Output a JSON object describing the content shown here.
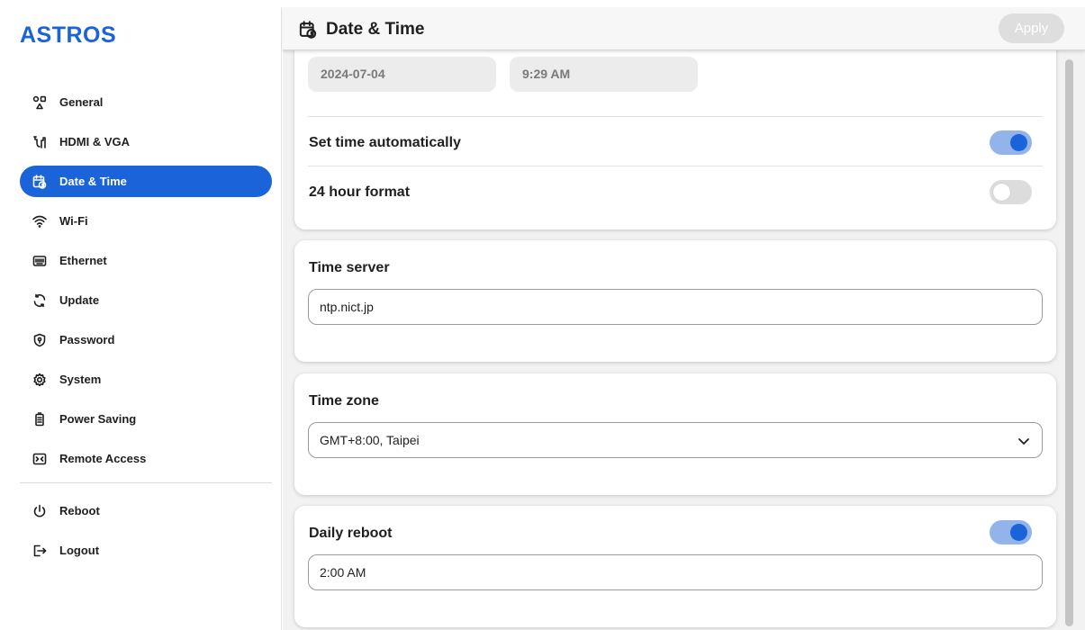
{
  "app": {
    "logo": "ASTROS"
  },
  "sidebar": {
    "items": [
      {
        "label": "General",
        "icon": "general-icon"
      },
      {
        "label": "HDMI & VGA",
        "icon": "hdmi-icon"
      },
      {
        "label": "Date & Time",
        "icon": "calendar-clock-icon",
        "active": true
      },
      {
        "label": "Wi-Fi",
        "icon": "wifi-icon"
      },
      {
        "label": "Ethernet",
        "icon": "ethernet-icon"
      },
      {
        "label": "Update",
        "icon": "update-icon"
      },
      {
        "label": "Password",
        "icon": "shield-lock-icon"
      },
      {
        "label": "System",
        "icon": "settings-icon"
      },
      {
        "label": "Power Saving",
        "icon": "battery-icon"
      },
      {
        "label": "Remote Access",
        "icon": "remote-icon"
      }
    ],
    "bottom_items": [
      {
        "label": "Reboot",
        "icon": "power-icon"
      },
      {
        "label": "Logout",
        "icon": "logout-icon"
      }
    ]
  },
  "header": {
    "title": "Date & Time",
    "apply_label": "Apply"
  },
  "datetime": {
    "date": "2024-07-04",
    "time": "9:29 AM",
    "auto_label": "Set time automatically",
    "auto_on": true,
    "h24_label": "24 hour format",
    "h24_on": false
  },
  "time_server": {
    "title": "Time server",
    "value": "ntp.nict.jp"
  },
  "time_zone": {
    "title": "Time zone",
    "value": "GMT+8:00, Taipei"
  },
  "daily_reboot": {
    "title": "Daily reboot",
    "enabled": true,
    "value": "2:00 AM"
  },
  "colors": {
    "accent": "#1a63d8",
    "toggle_track_on": "#93b4ea",
    "background": "#f2f2f2"
  }
}
